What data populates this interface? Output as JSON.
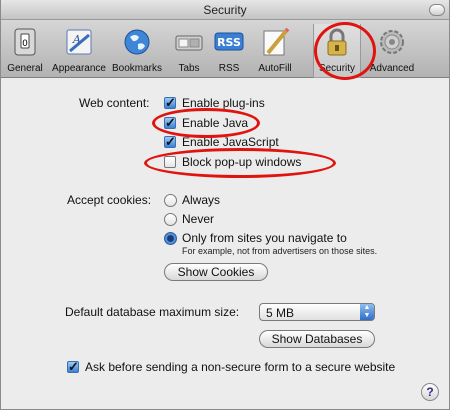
{
  "window": {
    "title": "Security"
  },
  "toolbar": {
    "items": [
      {
        "label": "General",
        "icon": "general-switch-icon"
      },
      {
        "label": "Appearance",
        "icon": "appearance-icon"
      },
      {
        "label": "Bookmarks",
        "icon": "globe-icon"
      },
      {
        "label": "Tabs",
        "icon": "tabs-icon"
      },
      {
        "label": "RSS",
        "icon": "rss-icon",
        "icon_text": "RSS"
      },
      {
        "label": "AutoFill",
        "icon": "autofill-pencil-icon"
      },
      {
        "label": "Security",
        "icon": "lock-icon",
        "selected": true
      },
      {
        "label": "Advanced",
        "icon": "gear-icon"
      }
    ]
  },
  "web_content": {
    "label": "Web content:",
    "options": [
      {
        "label": "Enable plug-ins",
        "checked": true
      },
      {
        "label": "Enable Java",
        "checked": true
      },
      {
        "label": "Enable JavaScript",
        "checked": true
      },
      {
        "label": "Block pop-up windows",
        "checked": false
      }
    ]
  },
  "cookies": {
    "label": "Accept cookies:",
    "options": [
      {
        "label": "Always",
        "selected": false
      },
      {
        "label": "Never",
        "selected": false
      },
      {
        "label": "Only from sites you navigate to",
        "selected": true
      }
    ],
    "note": "For example, not from advertisers on those sites.",
    "show_button": "Show Cookies"
  },
  "database": {
    "label": "Default database maximum size:",
    "value": "5 MB",
    "show_button": "Show Databases"
  },
  "nonsecure_form": {
    "label": "Ask before sending a non-secure form to a secure website",
    "checked": true
  },
  "help": {
    "glyph": "?"
  },
  "colors": {
    "highlight": "#e0140f",
    "accent": "#3a82d8"
  }
}
